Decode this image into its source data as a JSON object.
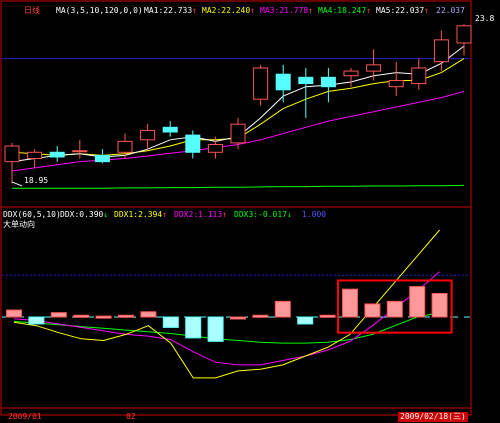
{
  "top_header": {
    "left_label": "日线",
    "ma_params": "MA(3,5,10,120,0,0)",
    "ma1": {
      "label": "MA1:",
      "value": "22.733",
      "arrow": "↑",
      "color": "#ffffff"
    },
    "ma2": {
      "label": "MA2:",
      "value": "22.240",
      "arrow": "↑",
      "color": "#ffff00"
    },
    "ma3": {
      "label": "MA3:",
      "value": "21.778",
      "arrow": "↑",
      "color": "#ff00ff"
    },
    "ma4": {
      "label": "MA4:",
      "value": "18.247",
      "arrow": "↑",
      "color": "#00ff00"
    },
    "ma5": {
      "label": "MA5:",
      "value": "22.037",
      "arrow": "↑",
      "color": "#ffffff"
    },
    "ma6_value": "22.037",
    "high_label": "23.8",
    "low_label": "18.95"
  },
  "bottom_header": {
    "indicator": "DDX(60,5,10)",
    "ddx": {
      "label": "DDX:",
      "value": "0.390",
      "arrow": "↓",
      "color": "#ffffff"
    },
    "ddx1": {
      "label": "DDX1:",
      "value": "2.394",
      "arrow": "↑",
      "color": "#ffff00"
    },
    "ddx2": {
      "label": "DDX2:",
      "value": "1.113",
      "arrow": "↑",
      "color": "#ff00ff"
    },
    "ddx3": {
      "label": "DDX3:",
      "value": "-0.017",
      "arrow": "↓",
      "color": "#00ff00"
    },
    "subtitle": "大单动向",
    "extra_value": "1.000"
  },
  "footer": {
    "left_date": "2009/01",
    "mid_date": "02",
    "right_date": "2009/02/18",
    "right_weekday": "三"
  },
  "colors": {
    "up": "#ff5555",
    "down": "#55ffff",
    "border": "#cc0000",
    "highlight": "#ff0000",
    "ma_white": "#ffffff",
    "ma_yellow": "#ffff00",
    "ma_magenta": "#ff00ff",
    "ma_green": "#00ff00",
    "blue_line": "#2222cc"
  },
  "chart_data": [
    {
      "type": "candlestick",
      "title": "",
      "ylim": [
        18.5,
        24.2
      ],
      "candles": [
        {
          "open": 19.6,
          "high": 20.2,
          "low": 18.9,
          "close": 20.1
        },
        {
          "open": 19.7,
          "high": 20.0,
          "low": 19.4,
          "close": 19.9
        },
        {
          "open": 19.9,
          "high": 20.1,
          "low": 19.6,
          "close": 19.75
        },
        {
          "open": 19.95,
          "high": 20.3,
          "low": 19.7,
          "close": 19.95
        },
        {
          "open": 19.8,
          "high": 20.0,
          "low": 19.55,
          "close": 19.6
        },
        {
          "open": 19.9,
          "high": 20.5,
          "low": 19.7,
          "close": 20.25
        },
        {
          "open": 20.3,
          "high": 20.8,
          "low": 20.0,
          "close": 20.6
        },
        {
          "open": 20.7,
          "high": 20.9,
          "low": 20.4,
          "close": 20.55
        },
        {
          "open": 20.45,
          "high": 20.6,
          "low": 19.7,
          "close": 19.9
        },
        {
          "open": 19.9,
          "high": 20.4,
          "low": 19.7,
          "close": 20.15
        },
        {
          "open": 20.2,
          "high": 21.0,
          "low": 20.0,
          "close": 20.8
        },
        {
          "open": 21.6,
          "high": 22.7,
          "low": 21.4,
          "close": 22.6
        },
        {
          "open": 22.4,
          "high": 22.7,
          "low": 21.5,
          "close": 21.9
        },
        {
          "open": 22.3,
          "high": 22.6,
          "low": 21.0,
          "close": 22.1
        },
        {
          "open": 22.3,
          "high": 22.6,
          "low": 21.5,
          "close": 22.0
        },
        {
          "open": 22.35,
          "high": 22.6,
          "low": 22.0,
          "close": 22.5
        },
        {
          "open": 22.5,
          "high": 23.2,
          "low": 22.2,
          "close": 22.7
        },
        {
          "open": 22.0,
          "high": 22.8,
          "low": 21.7,
          "close": 22.2
        },
        {
          "open": 22.1,
          "high": 22.9,
          "low": 21.9,
          "close": 22.6
        },
        {
          "open": 22.8,
          "high": 23.8,
          "low": 22.5,
          "close": 23.5
        },
        {
          "open": 23.4,
          "high": 24.0,
          "low": 23.0,
          "close": 23.95
        }
      ],
      "ma_white": [
        19.6,
        19.7,
        19.8,
        19.85,
        19.75,
        19.8,
        20.0,
        20.3,
        20.4,
        20.25,
        20.4,
        21.0,
        21.7,
        22.0,
        22.05,
        22.15,
        22.35,
        22.45,
        22.4,
        22.75,
        23.3
      ],
      "ma_yellow": [
        19.9,
        19.85,
        19.8,
        19.85,
        19.8,
        19.85,
        19.95,
        20.1,
        20.3,
        20.3,
        20.35,
        20.8,
        21.3,
        21.6,
        21.85,
        21.95,
        22.1,
        22.2,
        22.2,
        22.45,
        22.9
      ],
      "ma_magenta": [
        19.3,
        19.4,
        19.5,
        19.6,
        19.65,
        19.7,
        19.78,
        19.87,
        19.95,
        20.05,
        20.15,
        20.3,
        20.5,
        20.7,
        20.9,
        21.05,
        21.2,
        21.35,
        21.5,
        21.65,
        21.85
      ],
      "ma_green": [
        18.75,
        18.75,
        18.75,
        18.75,
        18.75,
        18.76,
        18.76,
        18.77,
        18.77,
        18.78,
        18.78,
        18.79,
        18.8,
        18.8,
        18.81,
        18.81,
        18.82,
        18.82,
        18.83,
        18.83,
        18.84
      ],
      "blue_level": 22.9
    },
    {
      "type": "bar",
      "title": "",
      "ylim": [
        -1.0,
        1.0
      ],
      "ddx": [
        0.08,
        -0.08,
        0.05,
        0.02,
        0.01,
        0.02,
        0.06,
        -0.12,
        -0.24,
        -0.28,
        0.0,
        0.02,
        0.18,
        -0.08,
        0.02,
        0.32,
        0.15,
        0.18,
        0.35,
        0.27
      ],
      "ddx1": [
        -0.06,
        -0.1,
        -0.18,
        -0.25,
        -0.27,
        -0.2,
        -0.1,
        -0.3,
        -0.7,
        -0.7,
        -0.62,
        -0.6,
        -0.55,
        -0.45,
        -0.35,
        -0.2,
        0.1,
        0.4,
        0.7,
        1.0
      ],
      "ddx2": [
        -0.02,
        -0.04,
        -0.08,
        -0.12,
        -0.16,
        -0.2,
        -0.22,
        -0.26,
        -0.4,
        -0.52,
        -0.55,
        -0.55,
        -0.5,
        -0.45,
        -0.38,
        -0.28,
        -0.1,
        0.1,
        0.3,
        0.52
      ],
      "ddx3": [
        -0.05,
        -0.07,
        -0.09,
        -0.11,
        -0.13,
        -0.15,
        -0.17,
        -0.19,
        -0.22,
        -0.25,
        -0.27,
        -0.29,
        -0.3,
        -0.3,
        -0.29,
        -0.26,
        -0.2,
        -0.1,
        0.0,
        0.05
      ],
      "dash_level": 0.0,
      "blue_level": 0.48,
      "highlight_from_index": 15
    }
  ]
}
